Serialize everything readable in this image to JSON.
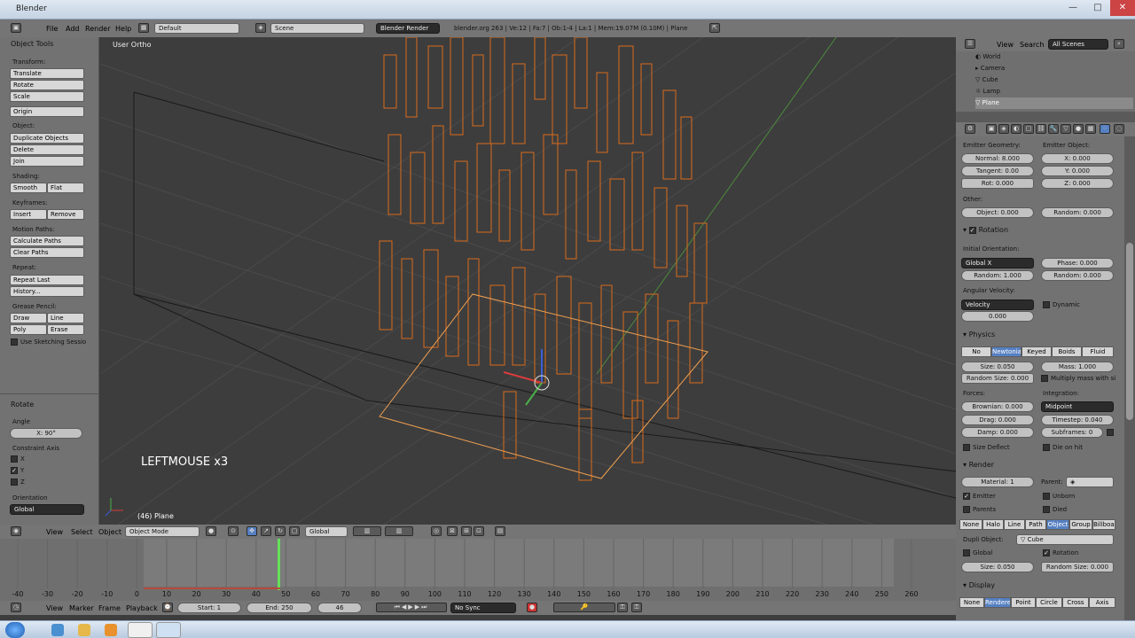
{
  "window": {
    "title": "Blender",
    "min": "—",
    "max": "□",
    "close": "✕"
  },
  "topbar": {
    "menus": [
      "File",
      "Add",
      "Render",
      "Help"
    ],
    "layout": "Default",
    "scene": "Scene",
    "engine": "Blender Render",
    "info": "blender.org 263 | Ve:12 | Fa:7 | Ob:1-4 | La:1 | Mem:19.07M (0.10M) | Plane"
  },
  "tools": {
    "header": "Object Tools",
    "transform_label": "Transform:",
    "translate": "Translate",
    "rotate": "Rotate",
    "scale": "Scale",
    "origin": "Origin",
    "object_label": "Object:",
    "duplicate": "Duplicate Objects",
    "delete": "Delete",
    "join": "Join",
    "shading_label": "Shading:",
    "smooth": "Smooth",
    "flat": "Flat",
    "keyframes_label": "Keyframes:",
    "insert": "Insert",
    "remove": "Remove",
    "motion_label": "Motion Paths:",
    "calc_paths": "Calculate Paths",
    "clear_paths": "Clear Paths",
    "repeat_label": "Repeat:",
    "repeat_last": "Repeat Last",
    "history": "History...",
    "grease_label": "Grease Pencil:",
    "draw": "Draw",
    "line": "Line",
    "poly": "Poly",
    "erase": "Erase",
    "sketching": "Use Sketching Sessio"
  },
  "operator": {
    "header": "Rotate",
    "angle_label": "Angle",
    "angle": "X: 90°",
    "constraint_label": "Constraint Axis",
    "x": "X",
    "y": "Y",
    "z": "Z",
    "orientation_label": "Orientation",
    "orientation": "Global"
  },
  "viewport": {
    "view_label": "User Ortho",
    "key_overlay": "LEFTMOUSE x3",
    "object_label": "(46) Plane"
  },
  "viewheader": {
    "view": "View",
    "select": "Select",
    "object": "Object",
    "mode": "Object Mode",
    "orientation": "Global"
  },
  "timeline": {
    "ticks": [
      "-40",
      "-30",
      "-20",
      "-10",
      "0",
      "10",
      "20",
      "30",
      "40",
      "50",
      "60",
      "70",
      "80",
      "90",
      "100",
      "110",
      "120",
      "130",
      "140",
      "150",
      "160",
      "170",
      "180",
      "190",
      "200",
      "210",
      "220",
      "230",
      "240",
      "250",
      "260"
    ],
    "current_frame": 46
  },
  "timeheader": {
    "view": "View",
    "marker": "Marker",
    "frame": "Frame",
    "playback": "Playback",
    "start": "Start: 1",
    "end": "End: 250",
    "current": "46",
    "sync": "No Sync"
  },
  "outliner": {
    "view": "View",
    "search": "Search",
    "filter": "All Scenes",
    "items": [
      "World",
      "Camera",
      "Cube",
      "Lamp",
      "Plane"
    ]
  },
  "props": {
    "emitter_geometry": "Emitter Geometry:",
    "emitter_object": "Emitter Object:",
    "normal": "Normal: 8.000",
    "tangent": "Tangent: 0.00",
    "rot": "Rot: 0.000",
    "ex": "X: 0.000",
    "ey": "Y: 0.000",
    "ez": "Z: 0.000",
    "other": "Other:",
    "object": "Object: 0.000",
    "random": "Random: 0.000",
    "rotation": "Rotation",
    "initial_orientation": "Initial Orientation:",
    "global_x": "Global X",
    "phase": "Phase: 0.000",
    "rot_random": "Random: 1.000",
    "rot_random2": "Random: 0.000",
    "angular_velocity": "Angular Velocity:",
    "velocity": "Velocity",
    "av_value": "0.000",
    "dynamic": "Dynamic",
    "physics": "Physics",
    "phys_tabs": [
      "No",
      "Newtonia",
      "Keyed",
      "Boids",
      "Fluid"
    ],
    "size": "Size: 0.050",
    "mass": "Mass: 1.000",
    "random_size": "Random Size: 0.000",
    "multiply_mass": "Multiply mass with si",
    "forces": "Forces:",
    "integration": "Integration:",
    "brownian": "Brownian: 0.000",
    "midpoint": "Midpoint",
    "drag": "Drag: 0.000",
    "timestep": "Timestep: 0.040",
    "damp": "Damp: 0.000",
    "subframes": "Subframes: 0",
    "size_deflect": "Size Deflect",
    "die_on_hit": "Die on hit",
    "render": "Render",
    "material": "Material: 1",
    "parent": "Parent:",
    "emitter": "Emitter",
    "unborn": "Unborn",
    "parents": "Parents",
    "died": "Died",
    "render_tabs": [
      "None",
      "Halo",
      "Line",
      "Path",
      "Object",
      "Group",
      "Billboar"
    ],
    "dupli_object": "Dupli Object:",
    "dupli_value": "Cube",
    "global": "Global",
    "rotation_chk": "Rotation",
    "dsize": "Size: 0.050",
    "drandom": "Random Size: 0.000",
    "display": "Display",
    "disp_tabs": [
      "None",
      "Rendere",
      "Point",
      "Circle",
      "Cross",
      "Axis"
    ]
  }
}
